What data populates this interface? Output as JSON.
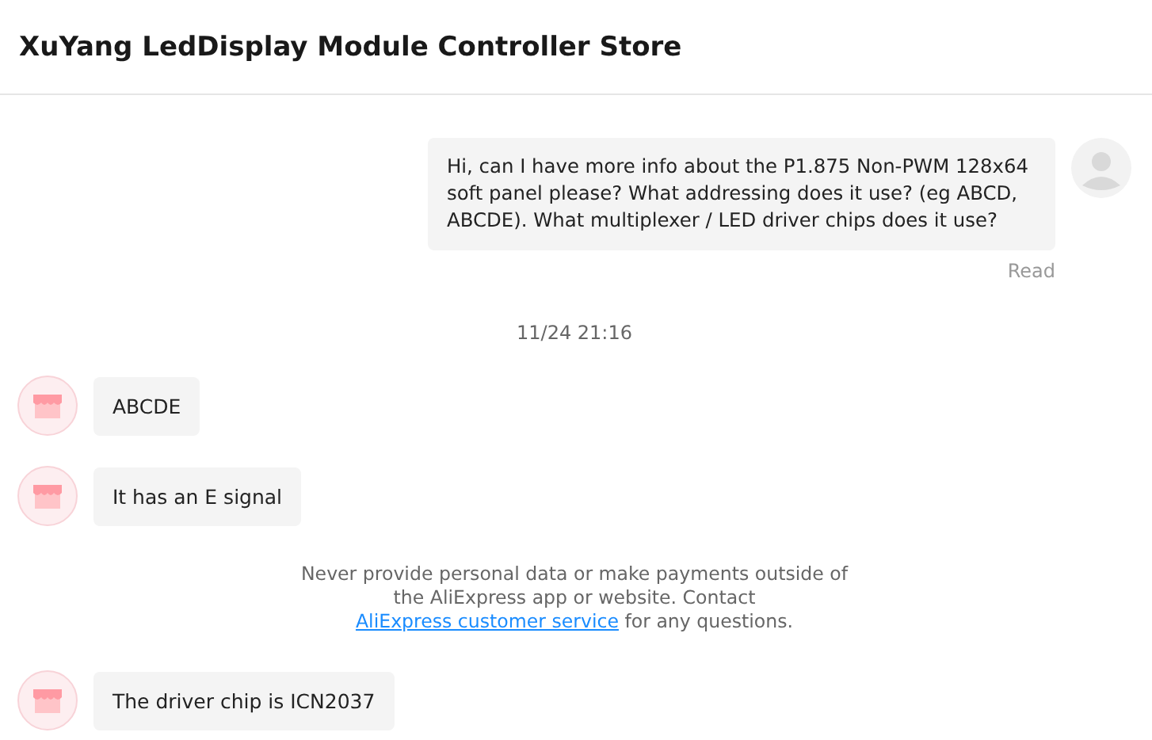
{
  "header": {
    "title": "XuYang LedDisplay Module Controller Store"
  },
  "messages": [
    {
      "kind": "outgoing",
      "text": "Hi, can I have more info about the P1.875 Non-PWM 128x64 soft panel please? What addressing does it use? (eg ABCD, ABCDE). What multiplexer / LED driver chips does it use?",
      "status": "Read"
    },
    {
      "kind": "timestamp",
      "text": "11/24 21:16"
    },
    {
      "kind": "incoming",
      "text": "ABCDE"
    },
    {
      "kind": "incoming",
      "text": "It has an E signal"
    },
    {
      "kind": "notice",
      "text_before": "Never provide personal data or make payments outside of the AliExpress app or website. Contact",
      "link": "AliExpress customer service",
      "text_after": "for any questions."
    },
    {
      "kind": "incoming",
      "text": "The driver chip is ICN2037"
    }
  ]
}
